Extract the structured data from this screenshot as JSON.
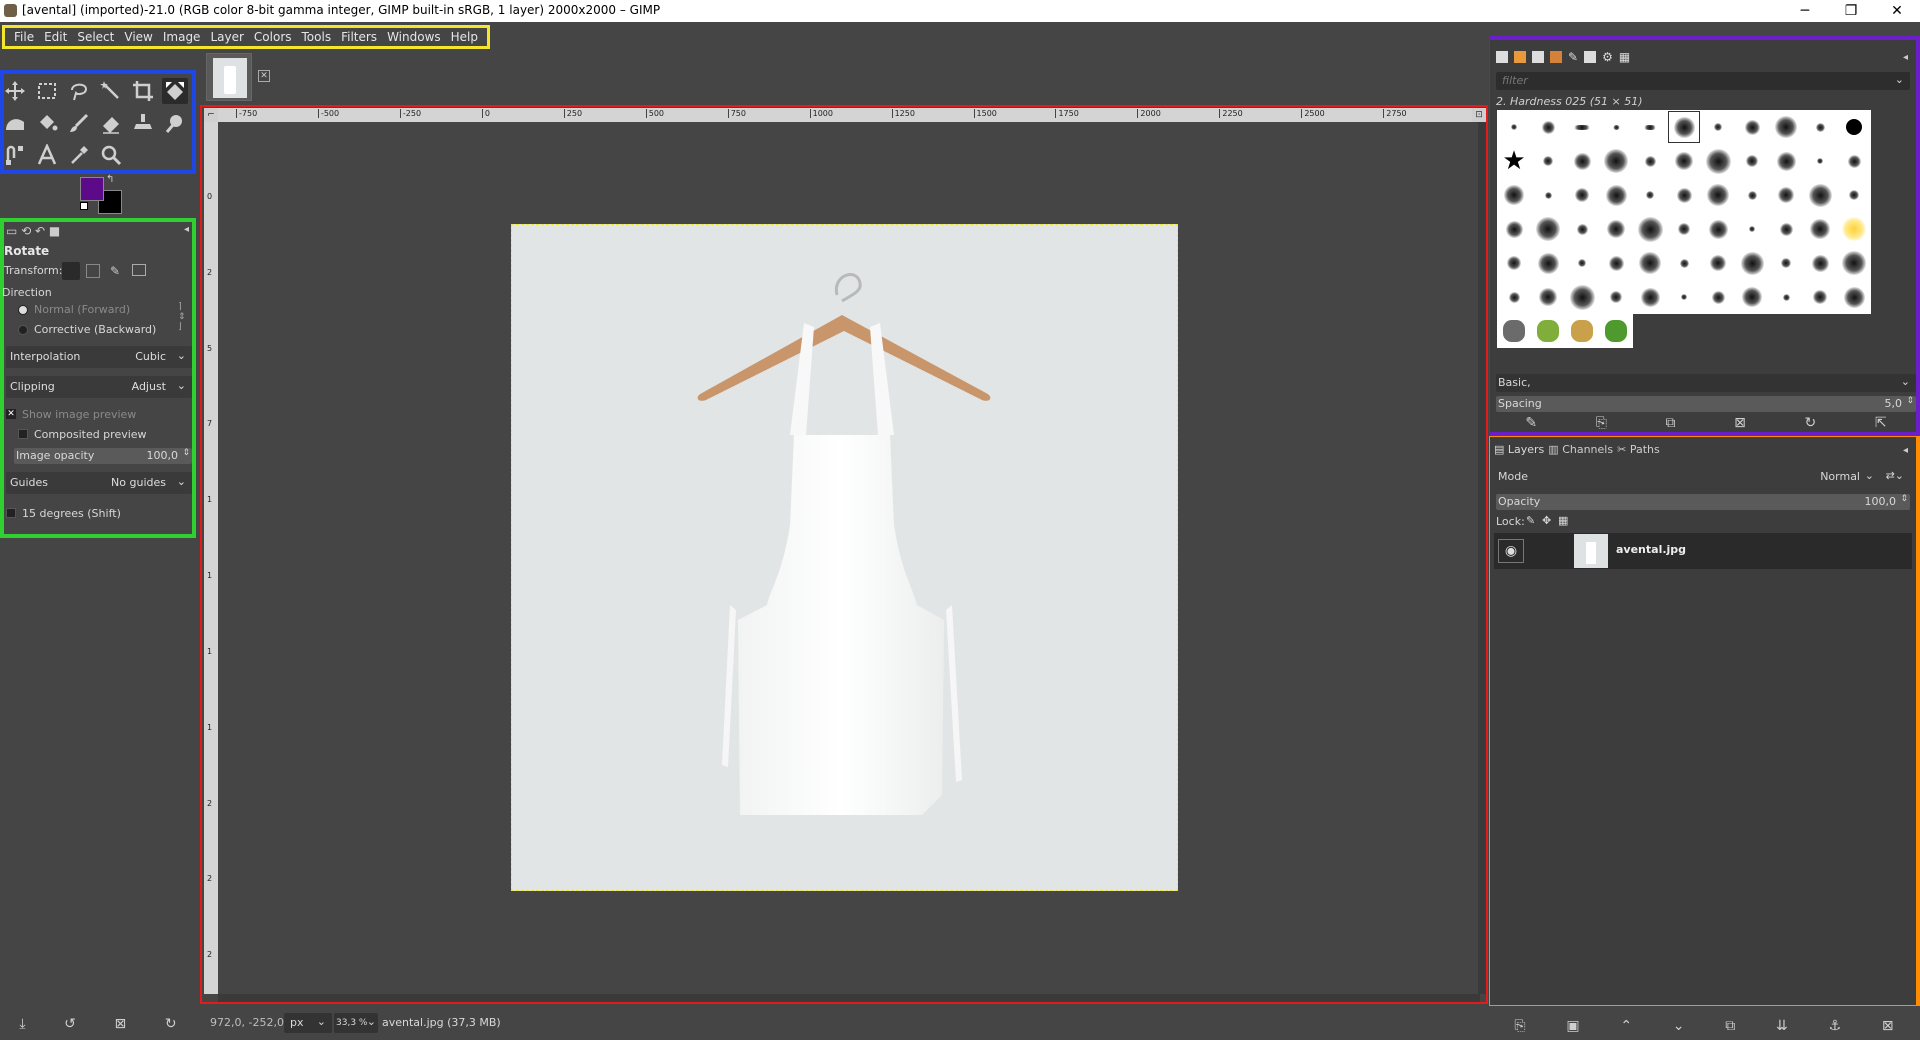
{
  "window": {
    "title": "[avental] (imported)-21.0 (RGB color 8-bit gamma integer, GIMP built-in sRGB, 1 layer) 2000x2000 – GIMP",
    "minimize": "─",
    "restore": "❐",
    "close": "✕"
  },
  "menu": [
    "File",
    "Edit",
    "Select",
    "View",
    "Image",
    "Layer",
    "Colors",
    "Tools",
    "Filters",
    "Windows",
    "Help"
  ],
  "tools": [
    "move-tool-icon",
    "rect-select-icon",
    "free-select-icon",
    "fuzzy-select-icon",
    "crop-icon",
    "unified-transform-icon",
    "warp-icon",
    "bucket-fill-icon",
    "paintbrush-icon",
    "eraser-icon",
    "clone-icon",
    "smudge-icon",
    "paths-icon",
    "text-tool-icon",
    "color-picker-icon",
    "zoom-icon"
  ],
  "colors": {
    "foreground": "#5c0a8a",
    "background": "#000000"
  },
  "tool_options": {
    "title": "Rotate",
    "transform_label": "Transform:",
    "direction_label": "Direction",
    "direction_normal": "Normal (Forward)",
    "direction_corrective": "Corrective (Backward)",
    "interpolation_label": "Interpolation",
    "interpolation_value": "Cubic",
    "clipping_label": "Clipping",
    "clipping_value": "Adjust",
    "show_preview": "Show image preview",
    "composited_preview": "Composited preview",
    "opacity_label": "Image opacity",
    "opacity_value": "100,0",
    "guides_label": "Guides",
    "guides_value": "No guides",
    "degrees": "15 degrees (Shift)"
  },
  "ruler": {
    "h_ticks": [
      "-750",
      "-500",
      "-250",
      "0",
      "250",
      "500",
      "750",
      "1000",
      "1250",
      "1500",
      "1750",
      "2000",
      "2250",
      "2500",
      "2750"
    ],
    "v_ticks": [
      "0",
      "2",
      "5",
      "7",
      "1",
      "1",
      "1",
      "1",
      "2",
      "2",
      "2"
    ]
  },
  "statusbar": {
    "coords": "972,0, -252,0",
    "unit": "px",
    "zoom": "33,3 %",
    "file": "avental.jpg (37,3 MB)"
  },
  "brushes": {
    "filter_placeholder": "filter",
    "brush_name": "2. Hardness 025 (51 × 51)",
    "preset": "Basic,",
    "spacing_label": "Spacing",
    "spacing_value": "5,0"
  },
  "layers": {
    "tab_layers": "Layers",
    "tab_channels": "Channels",
    "tab_paths": "Paths",
    "mode_label": "Mode",
    "mode_value": "Normal",
    "opacity_label": "Opacity",
    "opacity_value": "100,0",
    "lock_label": "Lock:",
    "layer_name": "avental.jpg"
  },
  "highlight_colors": {
    "menu": "#f2e52c",
    "toolbox": "#1f47e6",
    "tool_options": "#2fd02f",
    "canvas": "#e51b1b",
    "brushes": "#6a1fc8",
    "layers": "#ff8c00"
  }
}
